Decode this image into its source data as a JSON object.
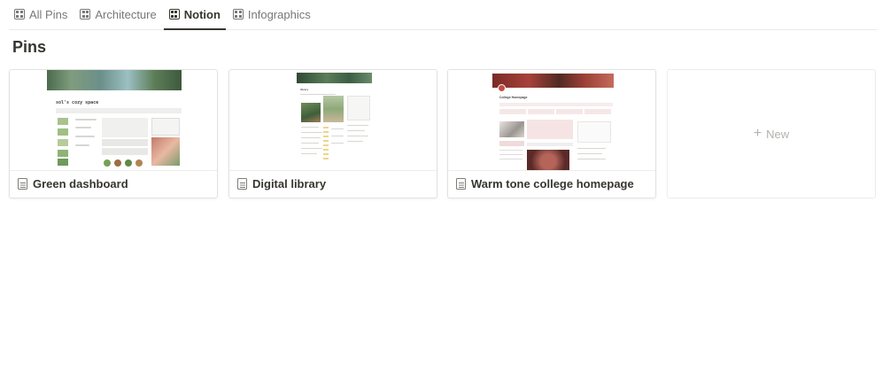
{
  "tabs": [
    {
      "label": "All Pins",
      "active": false
    },
    {
      "label": "Architecture",
      "active": false
    },
    {
      "label": "Notion",
      "active": true
    },
    {
      "label": "Infographics",
      "active": false
    }
  ],
  "page": {
    "title": "Pins"
  },
  "cards": [
    {
      "title": "Green dashboard",
      "thumb_heading": "sol's cozy space"
    },
    {
      "title": "Digital library",
      "thumb_heading": "library"
    },
    {
      "title": "Warm tone college homepage",
      "thumb_heading": "College Homepage"
    }
  ],
  "new_card": {
    "label": "New"
  },
  "colors": {
    "text": "#37352f",
    "muted": "#787774",
    "border": "#e2e2e0"
  }
}
